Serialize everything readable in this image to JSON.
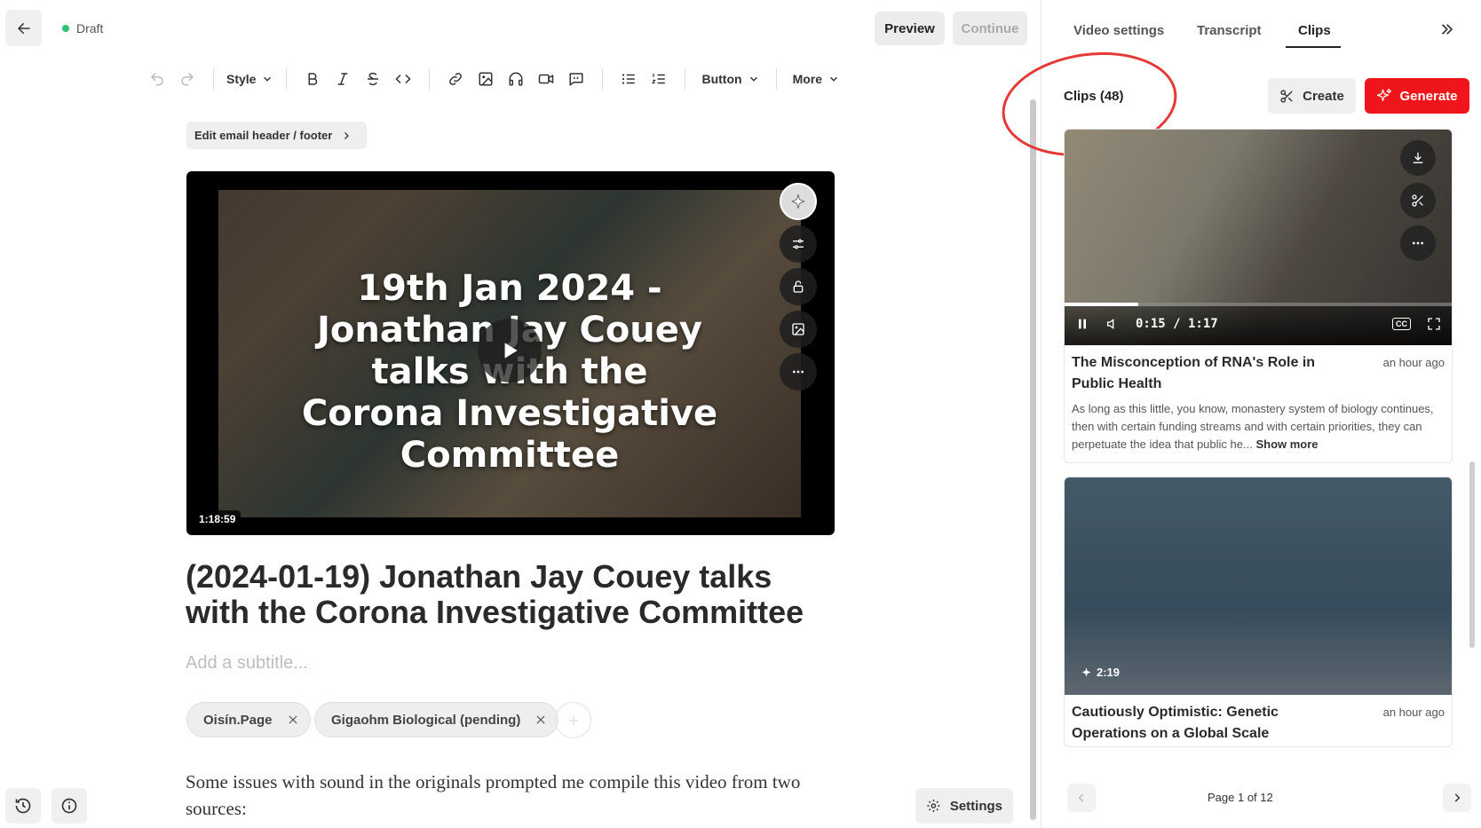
{
  "header": {
    "status": "Draft",
    "preview_label": "Preview",
    "continue_label": "Continue"
  },
  "toolbar": {
    "style_label": "Style",
    "button_label": "Button",
    "more_label": "More"
  },
  "editor": {
    "email_header_label": "Edit email header / footer",
    "video": {
      "overlay_title_lines": [
        "19th Jan 2024 -",
        "Jonathan Jay Couey",
        "talks with the",
        "Corona Investigative",
        "Committee"
      ],
      "duration": "1:18:59"
    },
    "title": "(2024-01-19) Jonathan Jay Couey talks with the Corona Investigative Committee",
    "subtitle_placeholder": "Add a subtitle...",
    "tags": [
      "Oisín.Page",
      "Gigaohm Biological (pending)"
    ],
    "body": "Some issues with sound in the originals prompted me compile this video from two sources:",
    "settings_label": "Settings"
  },
  "panel": {
    "tabs": [
      "Video settings",
      "Transcript",
      "Clips"
    ],
    "active_tab": "Clips",
    "clips_count_label": "Clips (48)",
    "create_label": "Create",
    "generate_label": "Generate",
    "generate_color": "#f0151a",
    "clips": [
      {
        "title": "The Misconception of RNA's Role in Public Health",
        "ago": "an hour ago",
        "time": "0:15 / 1:17",
        "progress": 0.19,
        "description": "As long as this little, you know, monastery system of biology continues, then with certain funding streams and with certain priorities, they can perpetuate the idea that public he...",
        "show_more": "Show more"
      },
      {
        "title": "Cautiously Optimistic: Genetic Operations on a Global Scale",
        "ago": "an hour ago",
        "duration": "2:19"
      }
    ],
    "pagination": "Page 1 of 12"
  }
}
